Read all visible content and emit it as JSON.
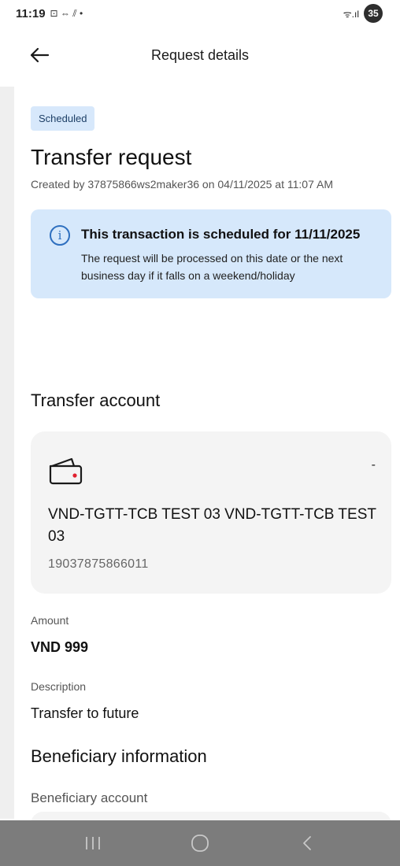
{
  "status_bar": {
    "time": "11:19",
    "indicators": "⊡ ⇔ ⫽ •",
    "signal": "ᯤ.ıl",
    "battery": "35"
  },
  "header": {
    "title": "Request details",
    "back_icon": "arrow-left-icon"
  },
  "request": {
    "status_badge": "Scheduled",
    "title": "Transfer request",
    "created_by": "Created by 37875866ws2maker36 on 04/11/2025 at 11:07 AM"
  },
  "notice": {
    "icon": "info-icon",
    "title": "This transaction is scheduled for 11/11/2025",
    "text": "The request will be processed on this date or the next business day if it falls on a weekend/holiday"
  },
  "transfer_account": {
    "section_title": "Transfer account",
    "icon": "wallet-icon",
    "balance": "-",
    "name": "VND-TGTT-TCB TEST 03 VND-TGTT-TCB TEST 03",
    "number": "19037875866011"
  },
  "details": {
    "amount_label": "Amount",
    "amount_value": "VND 999",
    "description_label": "Description",
    "description_value": "Transfer to future"
  },
  "beneficiary": {
    "section_title": "Beneficiary information",
    "account_label": "Beneficiary account"
  },
  "colors": {
    "badge_bg": "#d7e8fb",
    "notice_bg": "#d6e8fb",
    "info_icon": "#2e6fbf",
    "card_bg": "#f4f4f4",
    "nav_bar": "#7c7c7c",
    "wallet_dot": "#e0202f"
  },
  "nav": {
    "recents_icon": "recents-icon",
    "home_icon": "home-icon",
    "back_icon": "back-chevron-icon"
  }
}
